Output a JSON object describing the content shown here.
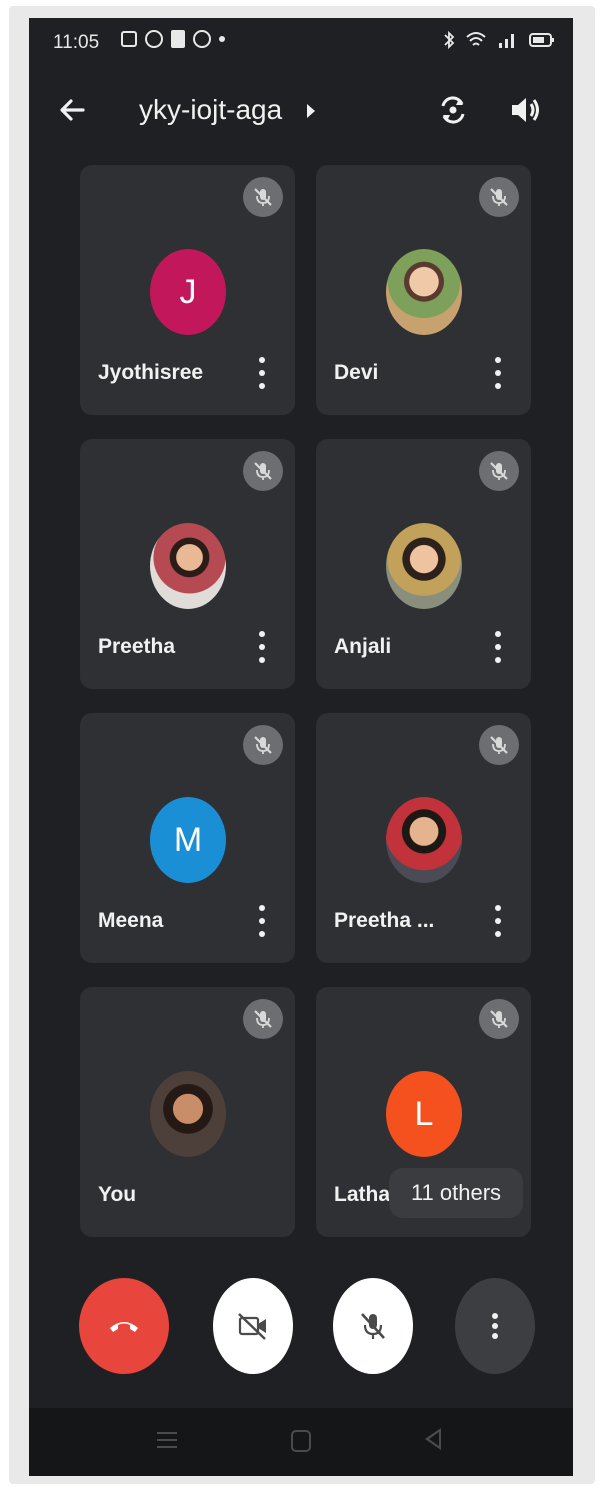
{
  "status_bar": {
    "time": "11:05"
  },
  "meeting": {
    "code": "yky-iojt-aga"
  },
  "participants": [
    {
      "name": "Jyothisree",
      "initial": "J",
      "avatar_color": "#c2185b"
    },
    {
      "name": "Devi"
    },
    {
      "name": "Preetha"
    },
    {
      "name": "Anjali"
    },
    {
      "name": "Meena",
      "initial": "M",
      "avatar_color": "#1a8fd6"
    },
    {
      "name": "Preetha ..."
    },
    {
      "name": "You"
    },
    {
      "name": "Latha",
      "initial": "L",
      "avatar_color": "#f4511e"
    }
  ],
  "overflow": {
    "others_label": "11 others"
  },
  "colors": {
    "background": "#1f2023",
    "tile": "#2e3033",
    "end_call": "#e8453c",
    "mute_badge": "#6c6e71"
  },
  "icons": [
    "back-arrow-icon",
    "flip-camera-icon",
    "speaker-icon",
    "mic-off-icon",
    "end-call-icon",
    "camera-off-icon",
    "more-vert-icon"
  ]
}
